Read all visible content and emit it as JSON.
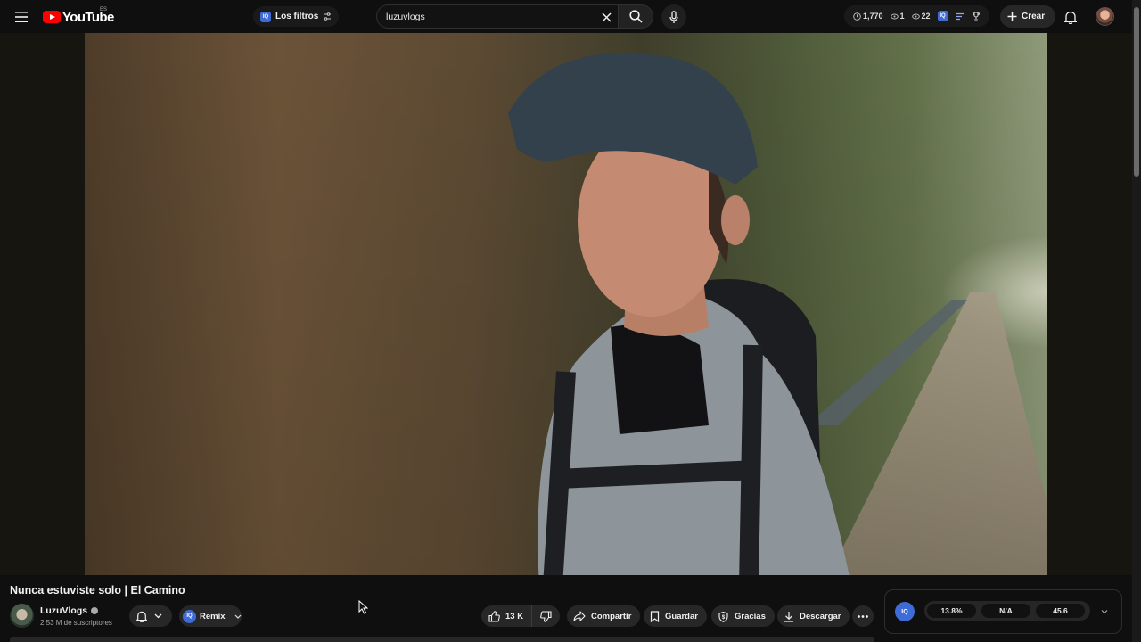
{
  "header": {
    "logo_text": "YouTube",
    "region": "ES",
    "filters_label": "Los filtros",
    "search_value": "luzuvlogs",
    "stats": {
      "watch_time": "1,770",
      "stat_two": "1",
      "stat_three": "22"
    },
    "create_label": "Crear"
  },
  "video": {
    "title": "Nunca estuviste solo | El Camino",
    "channel_name": "LuzuVlogs",
    "subscribers": "2,53 M de suscriptores",
    "remix_label": "Remix",
    "likes": "13 K",
    "share_label": "Compartir",
    "save_label": "Guardar",
    "thanks_label": "Gracias",
    "download_label": "Descargar"
  },
  "metrics": {
    "badge": "IQ",
    "values": [
      "13.8%",
      "N/A",
      "45.6"
    ]
  },
  "colors": {
    "background": "#0f0f0f",
    "brand_red": "#ff0000",
    "pill": "#272727",
    "iq_blue": "#3f6bd6"
  },
  "icons": [
    "menu-icon",
    "filter-icon",
    "close-icon",
    "search-icon",
    "mic-icon",
    "clock-icon",
    "eye-icon",
    "trophy-icon",
    "plus-icon",
    "bell-icon",
    "like-icon",
    "dislike-icon",
    "share-icon",
    "bookmark-icon",
    "thanks-icon",
    "download-icon",
    "more-icon",
    "chevron-down-icon"
  ]
}
